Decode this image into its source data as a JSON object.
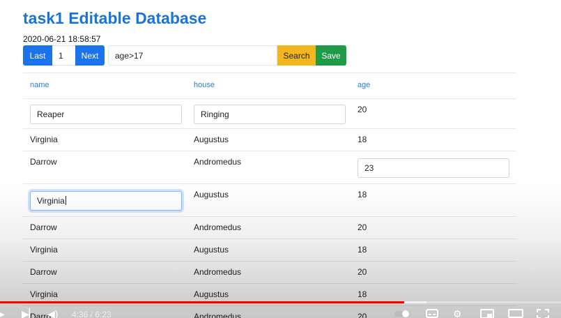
{
  "app": {
    "title": "task1 Editable Database",
    "timestamp": "2020-06-21 18:58:57"
  },
  "toolbar": {
    "last_label": "Last",
    "page_number": "1",
    "next_label": "Next",
    "query_value": "age>17",
    "search_label": "Search",
    "save_label": "Save"
  },
  "table": {
    "columns": [
      "name",
      "house",
      "age"
    ],
    "rows": [
      {
        "name": "Reaper",
        "house": "Ringing",
        "age": "20",
        "editing": [
          "name",
          "house"
        ]
      },
      {
        "name": "Virginia",
        "house": "Augustus",
        "age": "18",
        "editing": []
      },
      {
        "name": "Darrow",
        "house": "Andromedus",
        "age": "23",
        "editing": [
          "age"
        ]
      },
      {
        "name": "Virginia",
        "house": "Augustus",
        "age": "18",
        "editing": [
          "name"
        ]
      },
      {
        "name": "Darrow",
        "house": "Andromedus",
        "age": "20",
        "editing": []
      },
      {
        "name": "Virginia",
        "house": "Augustus",
        "age": "18",
        "editing": []
      },
      {
        "name": "Darrow",
        "house": "Andromedus",
        "age": "20",
        "editing": []
      },
      {
        "name": "Virginia",
        "house": "Augustus",
        "age": "18",
        "editing": []
      },
      {
        "name": "Darro",
        "house": "Andromedus",
        "age": "20",
        "editing": []
      }
    ]
  },
  "player": {
    "time": "4:36 / 6:23",
    "progress_fraction": 0.72,
    "buffer_fraction": 0.76
  },
  "icons": {
    "play": "play-icon",
    "next": "skip-next-icon",
    "volume": "volume-icon",
    "autoplay": "autoplay-toggle-icon",
    "subtitles": "subtitles-icon",
    "settings": "gear-icon",
    "miniplayer": "miniplayer-icon",
    "theater": "theater-mode-icon",
    "fullscreen": "fullscreen-icon"
  },
  "colors": {
    "accent": "#1a73e8",
    "search": "#f3b61f",
    "save": "#1f9a47",
    "progress": "#ff0000"
  }
}
